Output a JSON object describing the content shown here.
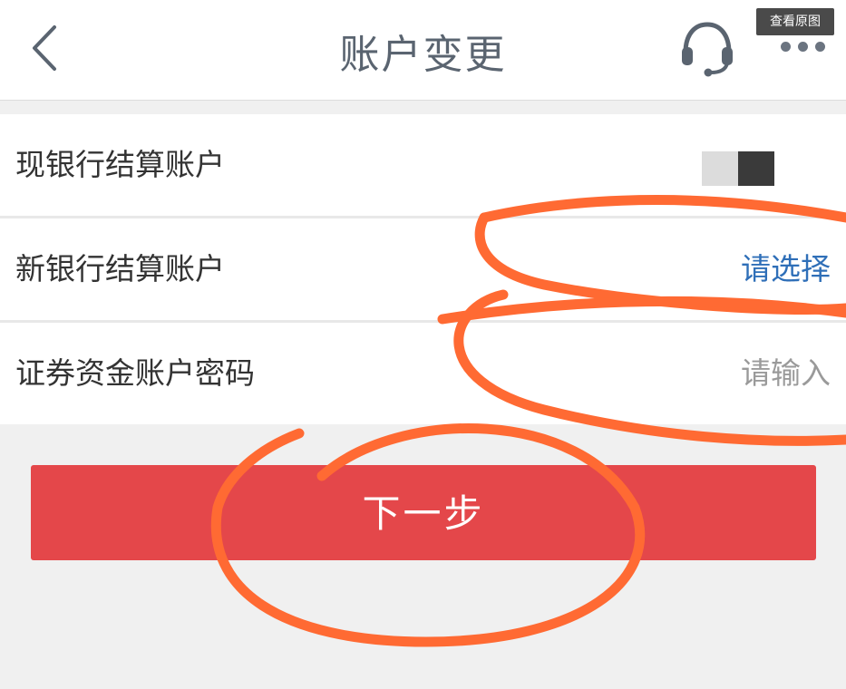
{
  "header": {
    "title": "账户变更",
    "back_icon": "chevron-left-icon",
    "headset_icon": "headset-icon",
    "more_icon": "more-dots-icon",
    "view_original": "查看原图"
  },
  "rows": [
    {
      "label": "现银行结算账户",
      "value": "",
      "control": "toggle"
    },
    {
      "label": "新银行结算账户",
      "value": "请选择",
      "value_color": "#2f6fb8"
    },
    {
      "label": "证券资金账户密码",
      "value": "请输入",
      "value_color": "#9a9a9a"
    }
  ],
  "next_button": {
    "label": "下一步",
    "color": "#e4474a"
  },
  "colors": {
    "background": "#f0f0f0",
    "title": "#5a6470",
    "annotation": "#ff6a33"
  }
}
